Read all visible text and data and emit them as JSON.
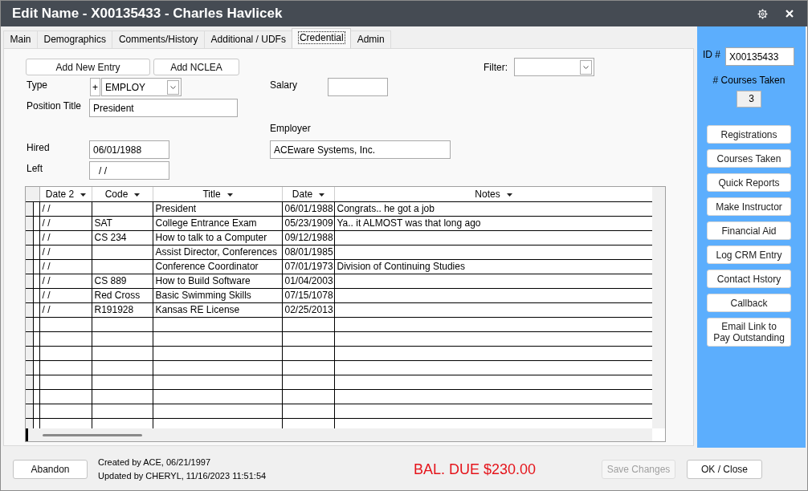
{
  "window": {
    "title": "Edit Name - X00135433 - Charles Havlicek"
  },
  "tabs": [
    {
      "label": "Main",
      "selected": false
    },
    {
      "label": "Demographics",
      "selected": false
    },
    {
      "label": "Comments/History",
      "selected": false
    },
    {
      "label": "Additional / UDFs",
      "selected": false
    },
    {
      "label": "Credential",
      "selected": true
    },
    {
      "label": "Admin",
      "selected": false
    }
  ],
  "entry_buttons": [
    "Add New Entry",
    "Add NCLEA"
  ],
  "filter": {
    "label": "Filter:"
  },
  "form": {
    "type": {
      "label": "Type",
      "add_button": "+",
      "value": "EMPLOY"
    },
    "salary": {
      "label": "Salary"
    },
    "position_title": {
      "label": "Position Title",
      "value": "President"
    },
    "employer": {
      "label": "Employer",
      "value": "ACEware Systems, Inc."
    },
    "hired": {
      "label": "Hired",
      "value": "06/01/1988"
    },
    "left": {
      "label": "Left",
      "value": "/ /"
    }
  },
  "table": {
    "columns": [
      "Date 2",
      "Code",
      "Title",
      "Date",
      "Notes"
    ],
    "rows": [
      {
        "date_2": "/ /",
        "title": "President",
        "date": "06/01/1988",
        "notes": "Congrats.. he got a job"
      },
      {
        "date_2": "/ /",
        "code": "SAT",
        "title": "College Entrance Exam",
        "date": "05/23/1909",
        "notes": "Ya.. it ALMOST was that long ago"
      },
      {
        "date_2": "/ /",
        "code": "CS 234",
        "title": "How to talk to a Computer",
        "date": "09/12/1988"
      },
      {
        "date_2": "/ /",
        "title": "Assist Director, Conferences",
        "date": "08/01/1985"
      },
      {
        "date_2": "/ /",
        "title": "Conference Coordinator",
        "date": "07/01/1973",
        "notes": "Division of Continuing Studies"
      },
      {
        "date_2": "/ /",
        "code": "CS 889",
        "title": "How to Build Software",
        "date": "01/04/2003"
      },
      {
        "date_2": "/ /",
        "code": "Red Cross",
        "title": "Basic Swimming Skills",
        "date": "07/15/1078"
      },
      {
        "date_2": "/ /",
        "code": "R191928",
        "title": "Kansas RE License",
        "date": "02/25/2013"
      }
    ]
  },
  "sidebar": {
    "id": {
      "label": "ID #",
      "value": "X00135433"
    },
    "courses_taken": {
      "label": "# Courses Taken",
      "value": "3"
    },
    "buttons": [
      "Registrations",
      "Courses Taken",
      "Quick Reports",
      "Make Instructor",
      "Financial Aid",
      "Log CRM Entry",
      "Contact Hstory",
      "Callback",
      "Email Link to Pay Outstanding"
    ]
  },
  "footer": {
    "abandon_button": "Abandon",
    "created": "Created by ACE, 06/21/1997",
    "updated": "Updated by CHERYL, 11/16/2023 11:51:54",
    "balance": "BAL. DUE $230.00",
    "buttons": [
      {
        "label": "Save Changes",
        "disabled": true
      },
      {
        "label": "OK / Close",
        "disabled": false
      }
    ]
  }
}
